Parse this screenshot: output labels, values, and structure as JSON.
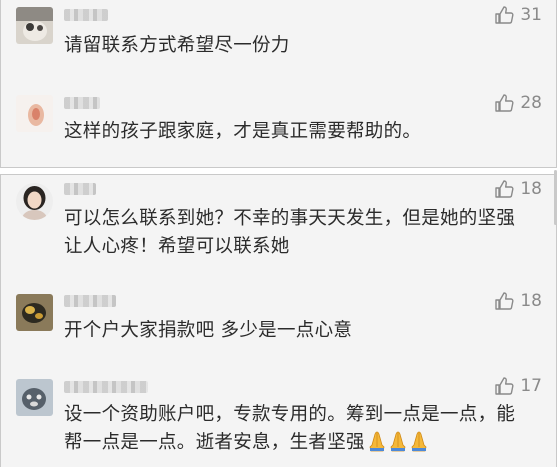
{
  "comments_group_1": [
    {
      "likes": "31",
      "text": "请留联系方式希望尽一份力"
    },
    {
      "likes": "28",
      "text": "这样的孩子跟家庭，才是真正需要帮助的。"
    }
  ],
  "comments_group_2": [
    {
      "likes": "18",
      "text": "可以怎么联系到她？不幸的事天天发生，但是她的坚强让人心疼！希望可以联系她"
    },
    {
      "likes": "18",
      "text": "开个户大家捐款吧 多少是一点心意"
    },
    {
      "likes": "17",
      "text": "设一个资助账户吧，专款专用的。筹到一点是一点，能帮一点是一点。逝者安息，生者坚强",
      "emoji": "pray-hands x3"
    }
  ],
  "colors": {
    "panel_background": "#f4f4f4",
    "text": "#2b2b2b",
    "like_text": "#8a8a8a"
  }
}
